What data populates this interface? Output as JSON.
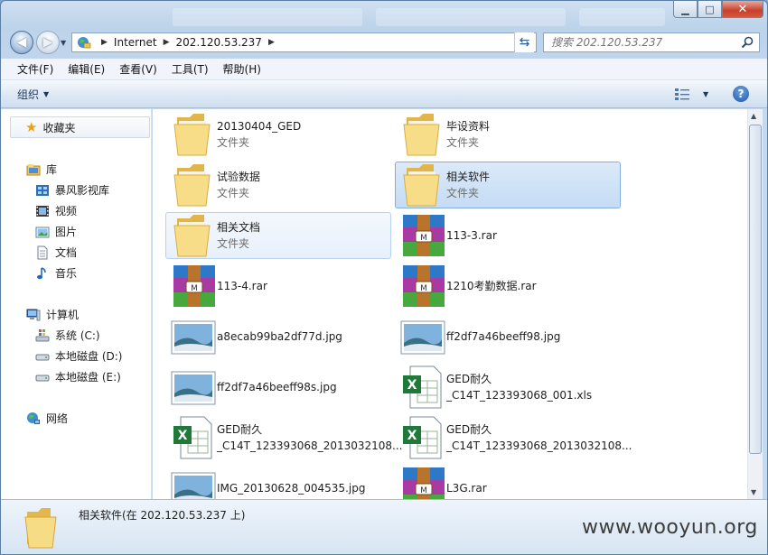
{
  "window": {
    "controls": [
      "minimize",
      "maximize",
      "close"
    ]
  },
  "address": {
    "crumbs": [
      "Internet",
      "202.120.53.237"
    ]
  },
  "search": {
    "placeholder": "搜索 202.120.53.237"
  },
  "menu": [
    "文件(F)",
    "编辑(E)",
    "查看(V)",
    "工具(T)",
    "帮助(H)"
  ],
  "toolbar": {
    "organize_label": "组织"
  },
  "nav": {
    "favorites": "收藏夹",
    "libraries": "库",
    "library_items": [
      "暴风影视库",
      "视频",
      "图片",
      "文档",
      "音乐"
    ],
    "computer": "计算机",
    "drives": [
      "系统 (C:)",
      "本地磁盘 (D:)",
      "本地磁盘 (E:)"
    ],
    "network": "网络"
  },
  "items": [
    {
      "name": "20130404_GED",
      "type": "文件夹",
      "kind": "folder"
    },
    {
      "name": "毕设资料",
      "type": "文件夹",
      "kind": "folder"
    },
    {
      "name": "试验数据",
      "type": "文件夹",
      "kind": "folder"
    },
    {
      "name": "相关软件",
      "type": "文件夹",
      "kind": "folder",
      "state": "selected"
    },
    {
      "name": "相关文档",
      "type": "文件夹",
      "kind": "folder",
      "state": "hover"
    },
    {
      "name": "113-3.rar",
      "type": "",
      "kind": "rar"
    },
    {
      "name": "113-4.rar",
      "type": "",
      "kind": "rar"
    },
    {
      "name": "1210考勤数据.rar",
      "type": "",
      "kind": "rar"
    },
    {
      "name": "a8ecab99ba2df77d.jpg",
      "type": "",
      "kind": "jpg"
    },
    {
      "name": "ff2df7a46beeff98.jpg",
      "type": "",
      "kind": "jpg"
    },
    {
      "name": "ff2df7a46beeff98s.jpg",
      "type": "",
      "kind": "jpg"
    },
    {
      "name": "GED耐久",
      "name2": "_C14T_123393068_001.xls",
      "type": "",
      "kind": "xls"
    },
    {
      "name": "GED耐久",
      "name2": "_C14T_123393068_2013032108...",
      "type": "",
      "kind": "xls"
    },
    {
      "name": "GED耐久",
      "name2": "_C14T_123393068_2013032108...",
      "type": "",
      "kind": "xls"
    },
    {
      "name": "IMG_20130628_004535.jpg",
      "type": "",
      "kind": "jpg"
    },
    {
      "name": "L3G.rar",
      "type": "",
      "kind": "rar"
    }
  ],
  "details": {
    "text": "相关软件(在 202.120.53.237 上)"
  },
  "watermark": "www.wooyun.org"
}
